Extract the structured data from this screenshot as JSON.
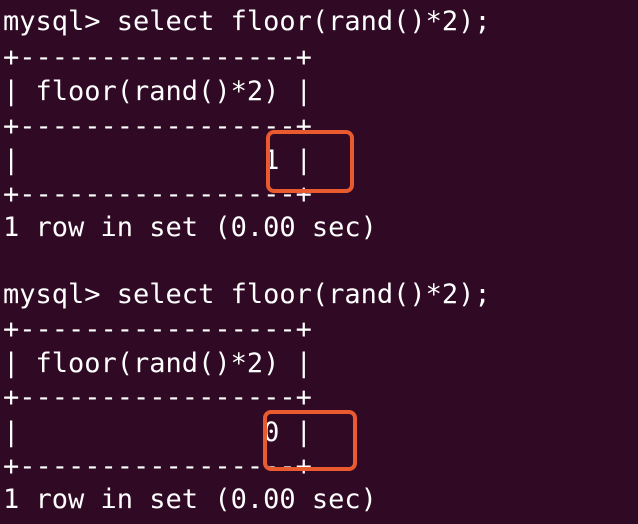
{
  "colors": {
    "background": "#300a24",
    "text": "#ffffff",
    "highlight": "#e95b2e"
  },
  "blocks": [
    {
      "prompt": "mysql> select floor(rand()*2);",
      "border_top": "+-----------------+",
      "header": "| floor(rand()*2) |",
      "border_mid": "+-----------------+",
      "row": "|               1 |",
      "border_bottom": "+-----------------+",
      "status": "1 row in set (0.00 sec)"
    },
    {
      "prompt": "mysql> select floor(rand()*2);",
      "border_top": "+-----------------+",
      "header": "| floor(rand()*2) |",
      "border_mid": "+-----------------+",
      "row": "|               0 |",
      "border_bottom": "+-----------------+",
      "status": "1 row in set (0.00 sec)"
    }
  ]
}
